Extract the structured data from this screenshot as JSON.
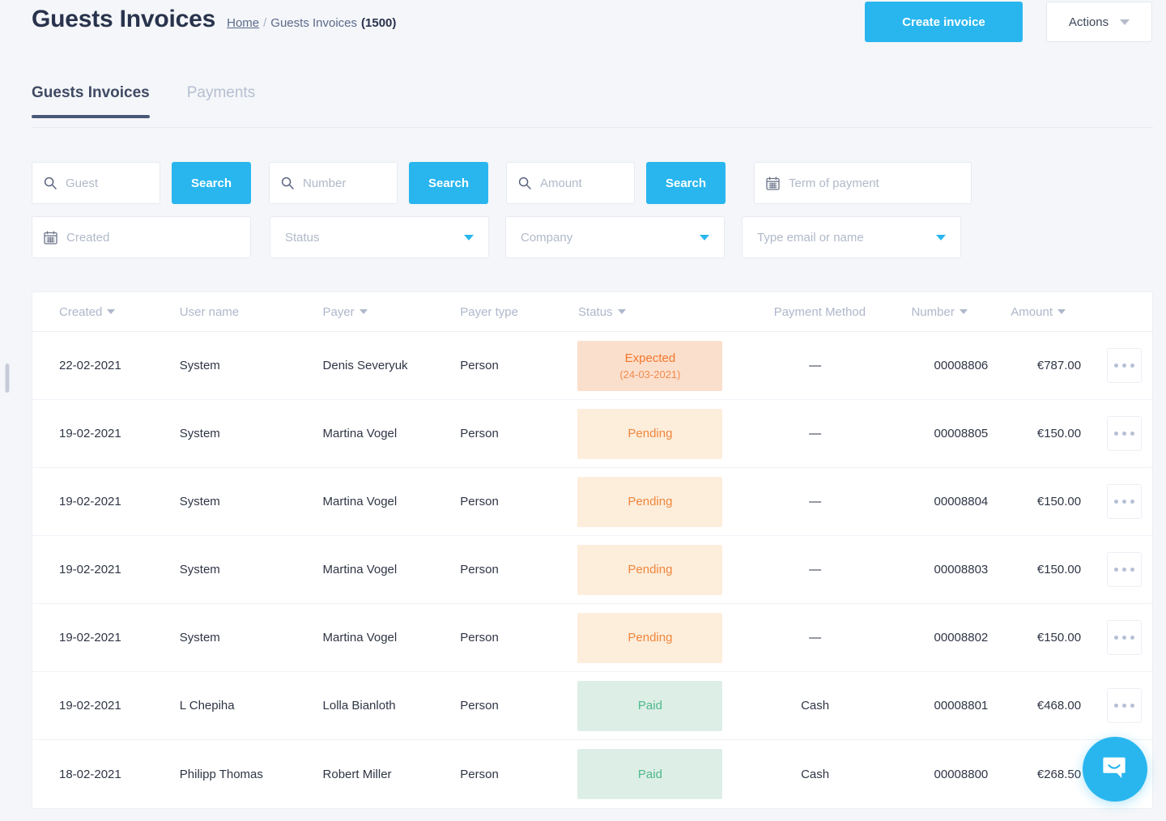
{
  "header": {
    "title": "Guests Invoices",
    "breadcrumb": {
      "home": "Home",
      "separator": "/",
      "current": "Guests Invoices",
      "count": "(1500)"
    },
    "create_button": "Create invoice",
    "actions_button": "Actions",
    "accent_color": "#29b6ef"
  },
  "tabs": [
    {
      "label": "Guests Invoices",
      "active": true
    },
    {
      "label": "Payments",
      "active": false
    }
  ],
  "filters": {
    "guest": {
      "placeholder": "Guest",
      "icon": "search-icon",
      "value": ""
    },
    "guest_search_button": "Search",
    "number": {
      "placeholder": "Number",
      "icon": "search-icon",
      "value": ""
    },
    "number_search_button": "Search",
    "amount": {
      "placeholder": "Amount",
      "icon": "search-icon",
      "value": ""
    },
    "amount_search_button": "Search",
    "term_of_payment": {
      "placeholder": "Term of payment",
      "icon": "calendar-icon",
      "value": ""
    },
    "created": {
      "placeholder": "Created",
      "icon": "calendar-icon",
      "value": ""
    },
    "status": {
      "placeholder": "Status",
      "icon": "chevron-down-icon",
      "value": ""
    },
    "company": {
      "placeholder": "Company",
      "icon": "chevron-down-icon",
      "value": ""
    },
    "email_or_name": {
      "placeholder": "Type email or name",
      "icon": "chevron-down-icon",
      "value": ""
    }
  },
  "table": {
    "columns": [
      {
        "label": "Created",
        "sortable": true
      },
      {
        "label": "User name",
        "sortable": false
      },
      {
        "label": "Payer",
        "sortable": true
      },
      {
        "label": "Payer type",
        "sortable": false
      },
      {
        "label": "Status",
        "sortable": true
      },
      {
        "label": "Payment Method",
        "sortable": false
      },
      {
        "label": "Number",
        "sortable": true
      },
      {
        "label": "Amount",
        "sortable": true
      }
    ],
    "rows": [
      {
        "created": "22-02-2021",
        "user_name": "System",
        "payer": "Denis Severyuk",
        "payer_type": "Person",
        "status": "Expected",
        "status_sub": "(24-03-2021)",
        "status_kind": "expected",
        "payment_method": "—",
        "number": "00008806",
        "amount": "€787.00"
      },
      {
        "created": "19-02-2021",
        "user_name": "System",
        "payer": "Martina Vogel",
        "payer_type": "Person",
        "status": "Pending",
        "status_sub": "",
        "status_kind": "pending",
        "payment_method": "—",
        "number": "00008805",
        "amount": "€150.00"
      },
      {
        "created": "19-02-2021",
        "user_name": "System",
        "payer": "Martina Vogel",
        "payer_type": "Person",
        "status": "Pending",
        "status_sub": "",
        "status_kind": "pending",
        "payment_method": "—",
        "number": "00008804",
        "amount": "€150.00"
      },
      {
        "created": "19-02-2021",
        "user_name": "System",
        "payer": "Martina Vogel",
        "payer_type": "Person",
        "status": "Pending",
        "status_sub": "",
        "status_kind": "pending",
        "payment_method": "—",
        "number": "00008803",
        "amount": "€150.00"
      },
      {
        "created": "19-02-2021",
        "user_name": "System",
        "payer": "Martina Vogel",
        "payer_type": "Person",
        "status": "Pending",
        "status_sub": "",
        "status_kind": "pending",
        "payment_method": "—",
        "number": "00008802",
        "amount": "€150.00"
      },
      {
        "created": "19-02-2021",
        "user_name": "L Chepiha",
        "payer": "Lolla Bianloth",
        "payer_type": "Person",
        "status": "Paid",
        "status_sub": "",
        "status_kind": "paid",
        "payment_method": "Cash",
        "number": "00008801",
        "amount": "€468.00"
      },
      {
        "created": "18-02-2021",
        "user_name": "Philipp Thomas",
        "payer": "Robert Miller",
        "payer_type": "Person",
        "status": "Paid",
        "status_sub": "",
        "status_kind": "paid",
        "payment_method": "Cash",
        "number": "00008800",
        "amount": "€268.50"
      }
    ],
    "row_action_icon": "ellipsis-icon"
  },
  "chat_launcher": {
    "icon": "chat-bubble-icon",
    "color": "#29b6ef"
  },
  "status_colors": {
    "expected_bg": "#fbdfcd",
    "expected_text": "#f3762a",
    "pending_bg": "#fdeddb",
    "pending_text": "#f0863c",
    "paid_bg": "#ddeee6",
    "paid_text": "#4cb88a"
  }
}
